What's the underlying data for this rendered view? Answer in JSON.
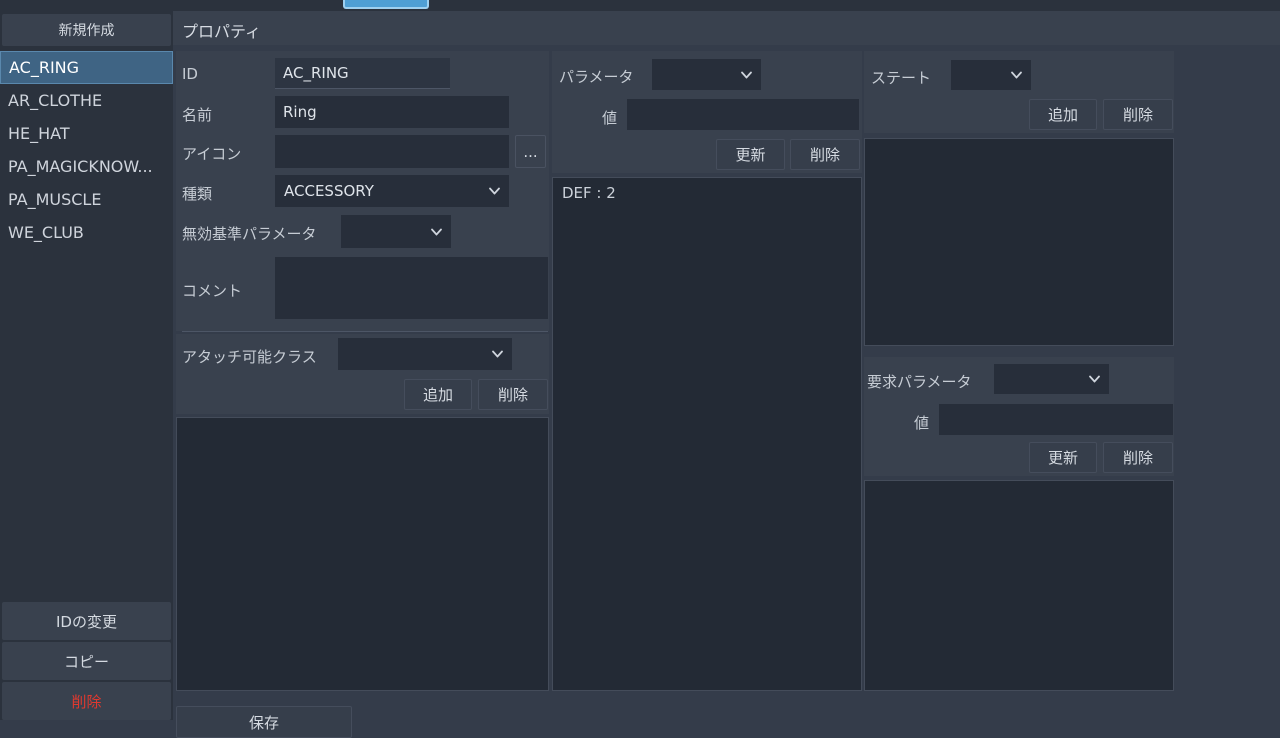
{
  "window": {
    "background_color": "#343c4a",
    "panel_color": "#39414e",
    "list_color": "#232a35",
    "accent_color": "#4f9fd4",
    "selection_color": "#3f6484",
    "danger_color": "#e0392f"
  },
  "tabs": {
    "active_tab_label": ""
  },
  "sidebar": {
    "new_button_label": "新規作成",
    "items": [
      {
        "label": "AC_RING",
        "selected": true
      },
      {
        "label": "AR_CLOTHE",
        "selected": false
      },
      {
        "label": "HE_HAT",
        "selected": false
      },
      {
        "label": "PA_MAGICKNOW...",
        "selected": false
      },
      {
        "label": "PA_MUSCLE",
        "selected": false
      },
      {
        "label": "WE_CLUB",
        "selected": false
      }
    ],
    "bottom_buttons": [
      {
        "label": "IDの変更",
        "style": "normal"
      },
      {
        "label": "コピー",
        "style": "normal"
      },
      {
        "label": "削除",
        "style": "danger"
      }
    ]
  },
  "header": {
    "title": "プロパティ"
  },
  "basic": {
    "id_label": "ID",
    "id_value": "AC_RING",
    "name_label": "名前",
    "name_value": "Ring",
    "icon_label": "アイコン",
    "icon_value": "",
    "icon_browse_label": "...",
    "kind_label": "種類",
    "kind_value": "ACCESSORY",
    "invalid_base_param_label": "無効基準パラメータ",
    "invalid_base_param_value": "",
    "comment_label": "コメント",
    "comment_value": ""
  },
  "attach": {
    "label": "アタッチ可能クラス",
    "value": "",
    "add_label": "追加",
    "delete_label": "削除",
    "list_items": []
  },
  "parameter": {
    "label": "パラメータ",
    "value": "",
    "value_label": "値",
    "value_field": "",
    "update_label": "更新",
    "delete_label": "削除",
    "list_items": [
      "DEF : 2"
    ]
  },
  "state": {
    "label": "ステート",
    "value": "",
    "add_label": "追加",
    "delete_label": "削除",
    "list_items": []
  },
  "required_param": {
    "label": "要求パラメータ",
    "value": "",
    "value_label": "値",
    "value_field": "",
    "update_label": "更新",
    "delete_label": "削除",
    "list_items": []
  },
  "footer": {
    "save_label": "保存"
  }
}
